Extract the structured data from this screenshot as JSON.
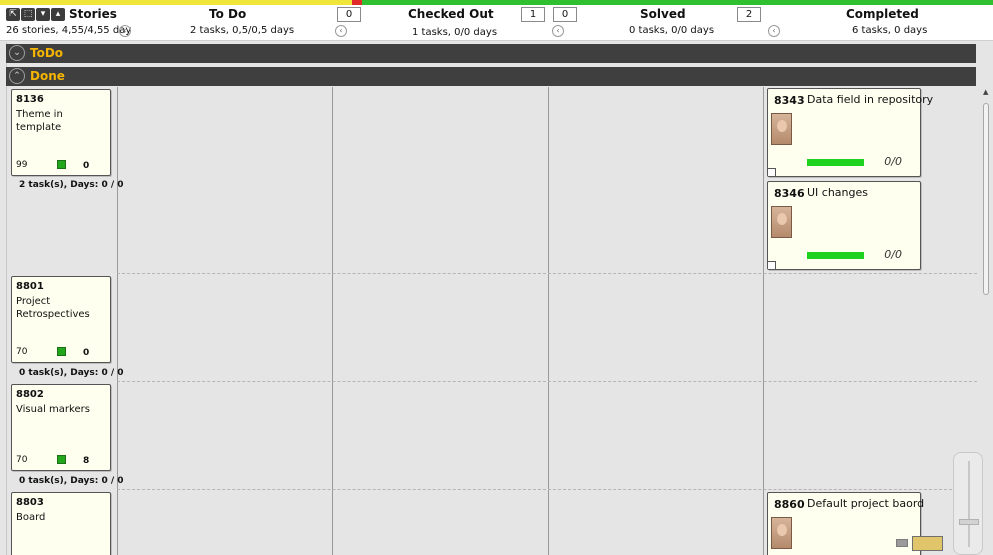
{
  "header": {
    "tools": [
      "cursor-icon",
      "select-icon",
      "dropdown-icon",
      "collapse-icon"
    ],
    "columns": [
      {
        "title": "Stories",
        "sub": "26 stories, 4,55/4,55 day"
      },
      {
        "title": "To Do",
        "sub": "2 tasks, 0,5/0,5 days",
        "counts": [
          "0"
        ]
      },
      {
        "title": "Checked Out",
        "sub": "1 tasks, 0/0 days",
        "counts": [
          "1",
          "0"
        ]
      },
      {
        "title": "Solved",
        "sub": "0 tasks, 0/0 days",
        "counts": [
          "2"
        ]
      },
      {
        "title": "Completed",
        "sub": "6 tasks, 0 days"
      }
    ]
  },
  "lanes": [
    {
      "label": "ToDo"
    },
    {
      "label": "Done"
    }
  ],
  "stories": [
    {
      "id": "8136",
      "name": "Theme in template",
      "points": "99",
      "count": "0",
      "summary": "2 task(s), Days:  0 / 0"
    },
    {
      "id": "8801",
      "name": "Project Retrospectives",
      "points": "70",
      "count": "0",
      "summary": "0 task(s), Days:  0 / 0"
    },
    {
      "id": "8802",
      "name": "Visual markers",
      "points": "70",
      "count": "8",
      "summary": "0 task(s), Days:  0 / 0"
    },
    {
      "id": "8803",
      "name": "Board",
      "points": "",
      "count": "",
      "summary": ""
    }
  ],
  "tasks": [
    {
      "id": "8343",
      "title": "Data field in repository",
      "ratio": "0/0"
    },
    {
      "id": "8346",
      "title": "UI changes",
      "ratio": "0/0"
    },
    {
      "id": "8860",
      "title": "Default project baord",
      "ratio": ""
    }
  ],
  "colors": {
    "accent": "#f4b400",
    "progress": "#1fd21f",
    "lane_bar": "#3f3f3f"
  }
}
